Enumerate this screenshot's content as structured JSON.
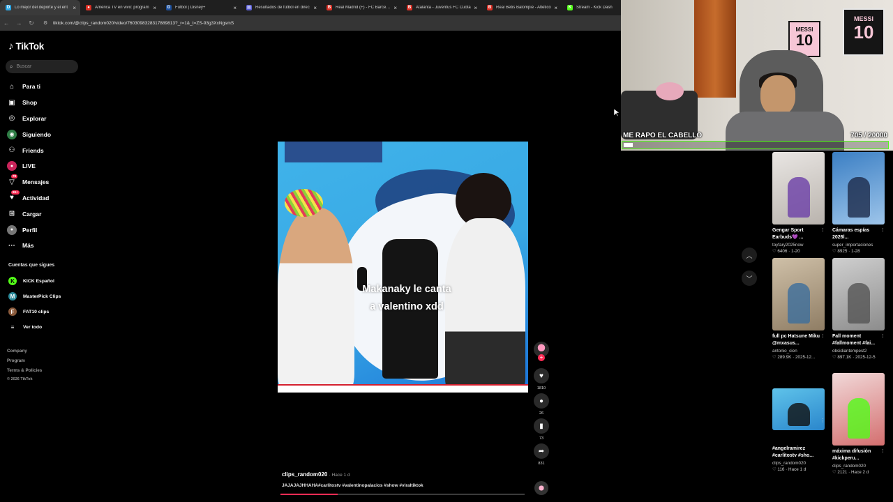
{
  "browser": {
    "tabs": [
      {
        "label": "Lo mejor del deporte y el ent",
        "color": "#2da8e8",
        "glyph": "D"
      },
      {
        "label": "América TV en vivo: program",
        "color": "#d93025",
        "glyph": "●"
      },
      {
        "label": "Fútbol | Disney+",
        "color": "#1b4e9b",
        "glyph": "D"
      },
      {
        "label": "Resultados de fútbol en direc",
        "color": "#5b5fd6",
        "glyph": "▤"
      },
      {
        "label": "Real Madrid (F) - FC Barcelon",
        "color": "#d93025",
        "glyph": "B"
      },
      {
        "label": "Atalanta - Juventus FC Cuota",
        "color": "#d93025",
        "glyph": "B"
      },
      {
        "label": "Real Betis Balompié - Atlético",
        "color": "#d93025",
        "glyph": "B"
      },
      {
        "label": "Stream - Kick Dash",
        "color": "#53fc18",
        "glyph": "K"
      }
    ],
    "url": "tiktok.com/@clips_random020/video/7603098328317889813?_r=1&_t=ZS-93g3XxNgsmS"
  },
  "sidebar": {
    "logo": "TikTok",
    "search_placeholder": "Buscar",
    "nav": [
      {
        "label": "Para ti",
        "icon": "home-icon",
        "glyph": "⌂"
      },
      {
        "label": "Shop",
        "icon": "shop-icon",
        "glyph": "▣"
      },
      {
        "label": "Explorar",
        "icon": "compass-icon",
        "glyph": "◎"
      },
      {
        "label": "Siguiendo",
        "icon": "following-icon",
        "glyph": "◉"
      },
      {
        "label": "Friends",
        "icon": "friends-icon",
        "glyph": "⚇"
      },
      {
        "label": "LIVE",
        "icon": "live-icon",
        "glyph": "●"
      },
      {
        "label": "Mensajes",
        "icon": "messages-icon",
        "glyph": "▽",
        "badge": "78"
      },
      {
        "label": "Actividad",
        "icon": "activity-icon",
        "glyph": "♥",
        "badge": "99+"
      },
      {
        "label": "Cargar",
        "icon": "upload-icon",
        "glyph": "⊞"
      },
      {
        "label": "Perfil",
        "icon": "profile-icon",
        "glyph": "●"
      },
      {
        "label": "Más",
        "icon": "more-icon",
        "glyph": "···"
      }
    ],
    "following_title": "Cuentas que sigues",
    "following": [
      {
        "label": "KICK Español",
        "color": "#53fc18",
        "glyph": "K"
      },
      {
        "label": "MasterPick Clips",
        "color": "#2b8a9a",
        "glyph": "M"
      },
      {
        "label": "FAT10 clips",
        "color": "#8a5a3b",
        "glyph": "F"
      },
      {
        "label": "Ver todo",
        "color": "transparent",
        "glyph": "≡"
      }
    ],
    "footer": [
      "Company",
      "Program",
      "Terms & Policies"
    ],
    "copyright": "© 2026 TikTok"
  },
  "video": {
    "caption_line1": "Makanaky le canta",
    "caption_line2": "a valentino xdd",
    "likes": "1810",
    "comments": "26",
    "saves": "73",
    "shares": "831",
    "username": "clips_random020",
    "ago": "· Hace 1 d",
    "description": "JAJAJAJHHAHA#carlitostv #valentinopalacios #show #viraltiktok",
    "progress": 0.235
  },
  "recommendations": [
    {
      "title": "Gengar Sport Earbuds💜 ...",
      "author": "toyfary2025now",
      "stats": "♡ 6406 · 1-20",
      "bg": "linear-gradient(160deg,#e9e6e3,#b9b3ad)",
      "accent": "#6b3fa8"
    },
    {
      "title": "Cámaras espías 2026l...",
      "author": "super_importaciones",
      "stats": "♡ 8925 · 1-28",
      "bg": "linear-gradient(160deg,#3b7fc4,#9ec5ea)",
      "accent": "#1d2b4a"
    },
    {
      "title": "full pc Hatsune Miku @mxasus...",
      "author": "antonio_cien",
      "stats": "♡ 289.9K · 2025-12...",
      "bg": "linear-gradient(160deg,#cfc0a8,#8f7d64)",
      "accent": "#3c6e9c"
    },
    {
      "title": "Fall moment #fallmoment #fai...",
      "author": "obsidiantempest2",
      "stats": "♡ 897.1K · 2025-12-5",
      "bg": "linear-gradient(160deg,#cfcfcf,#8c8c8c)",
      "accent": "#555"
    },
    {
      "title": "#angelramirez #carlitostv #sho...",
      "author": "clips_random020",
      "stats": "♡ 116 · Hace 1 d",
      "bg": "linear-gradient(160deg,#5fc3ea,#2a86cc)",
      "accent": "#101010"
    },
    {
      "title": "máxima difusión #kickperu...",
      "author": "clips_random020",
      "stats": "♡ 2121 · Hace 2 d",
      "bg": "linear-gradient(160deg,#f1d9d9,#d46f6f)",
      "accent": "#53fc18"
    }
  ],
  "stream_overlay": {
    "goal_title": "ME RAPO EL CABELLO",
    "goal_count": "705   / 20000",
    "goal_progress": 0.035,
    "poster_text": "MESSI",
    "poster_number": "10"
  }
}
